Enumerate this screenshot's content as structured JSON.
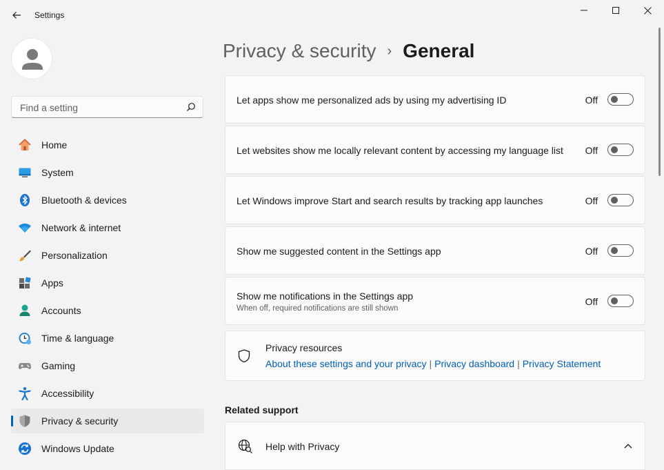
{
  "app": {
    "title": "Settings"
  },
  "search": {
    "placeholder": "Find a setting"
  },
  "sidebar": {
    "items": [
      {
        "label": "Home",
        "icon": "home-icon"
      },
      {
        "label": "System",
        "icon": "system-icon"
      },
      {
        "label": "Bluetooth & devices",
        "icon": "bluetooth-icon"
      },
      {
        "label": "Network & internet",
        "icon": "wifi-icon"
      },
      {
        "label": "Personalization",
        "icon": "brush-icon"
      },
      {
        "label": "Apps",
        "icon": "apps-icon"
      },
      {
        "label": "Accounts",
        "icon": "accounts-icon"
      },
      {
        "label": "Time & language",
        "icon": "clock-globe-icon"
      },
      {
        "label": "Gaming",
        "icon": "gamepad-icon"
      },
      {
        "label": "Accessibility",
        "icon": "accessibility-icon"
      },
      {
        "label": "Privacy & security",
        "icon": "shield-icon",
        "selected": true
      },
      {
        "label": "Windows Update",
        "icon": "update-icon"
      }
    ]
  },
  "breadcrumb": {
    "parent": "Privacy & security",
    "separator": "›",
    "current": "General"
  },
  "settings": [
    {
      "label": "Let apps show me personalized ads by using my advertising ID",
      "state": "Off"
    },
    {
      "label": "Let websites show me locally relevant content by accessing my language list",
      "state": "Off"
    },
    {
      "label": "Let Windows improve Start and search results by tracking app launches",
      "state": "Off"
    },
    {
      "label": "Show me suggested content in the Settings app",
      "state": "Off"
    },
    {
      "label": "Show me notifications in the Settings app",
      "description": "When off, required notifications are still shown",
      "state": "Off"
    }
  ],
  "privacy_resources": {
    "title": "Privacy resources",
    "links": [
      "About these settings and your privacy",
      "Privacy dashboard",
      "Privacy Statement"
    ],
    "separator": "|"
  },
  "related_support": {
    "title": "Related support",
    "items": [
      {
        "label": "Help with Privacy"
      }
    ]
  },
  "colors": {
    "accent": "#005fb8",
    "background": "#f3f3f3",
    "card": "#fbfbfb",
    "text": "#1b1b1b"
  }
}
